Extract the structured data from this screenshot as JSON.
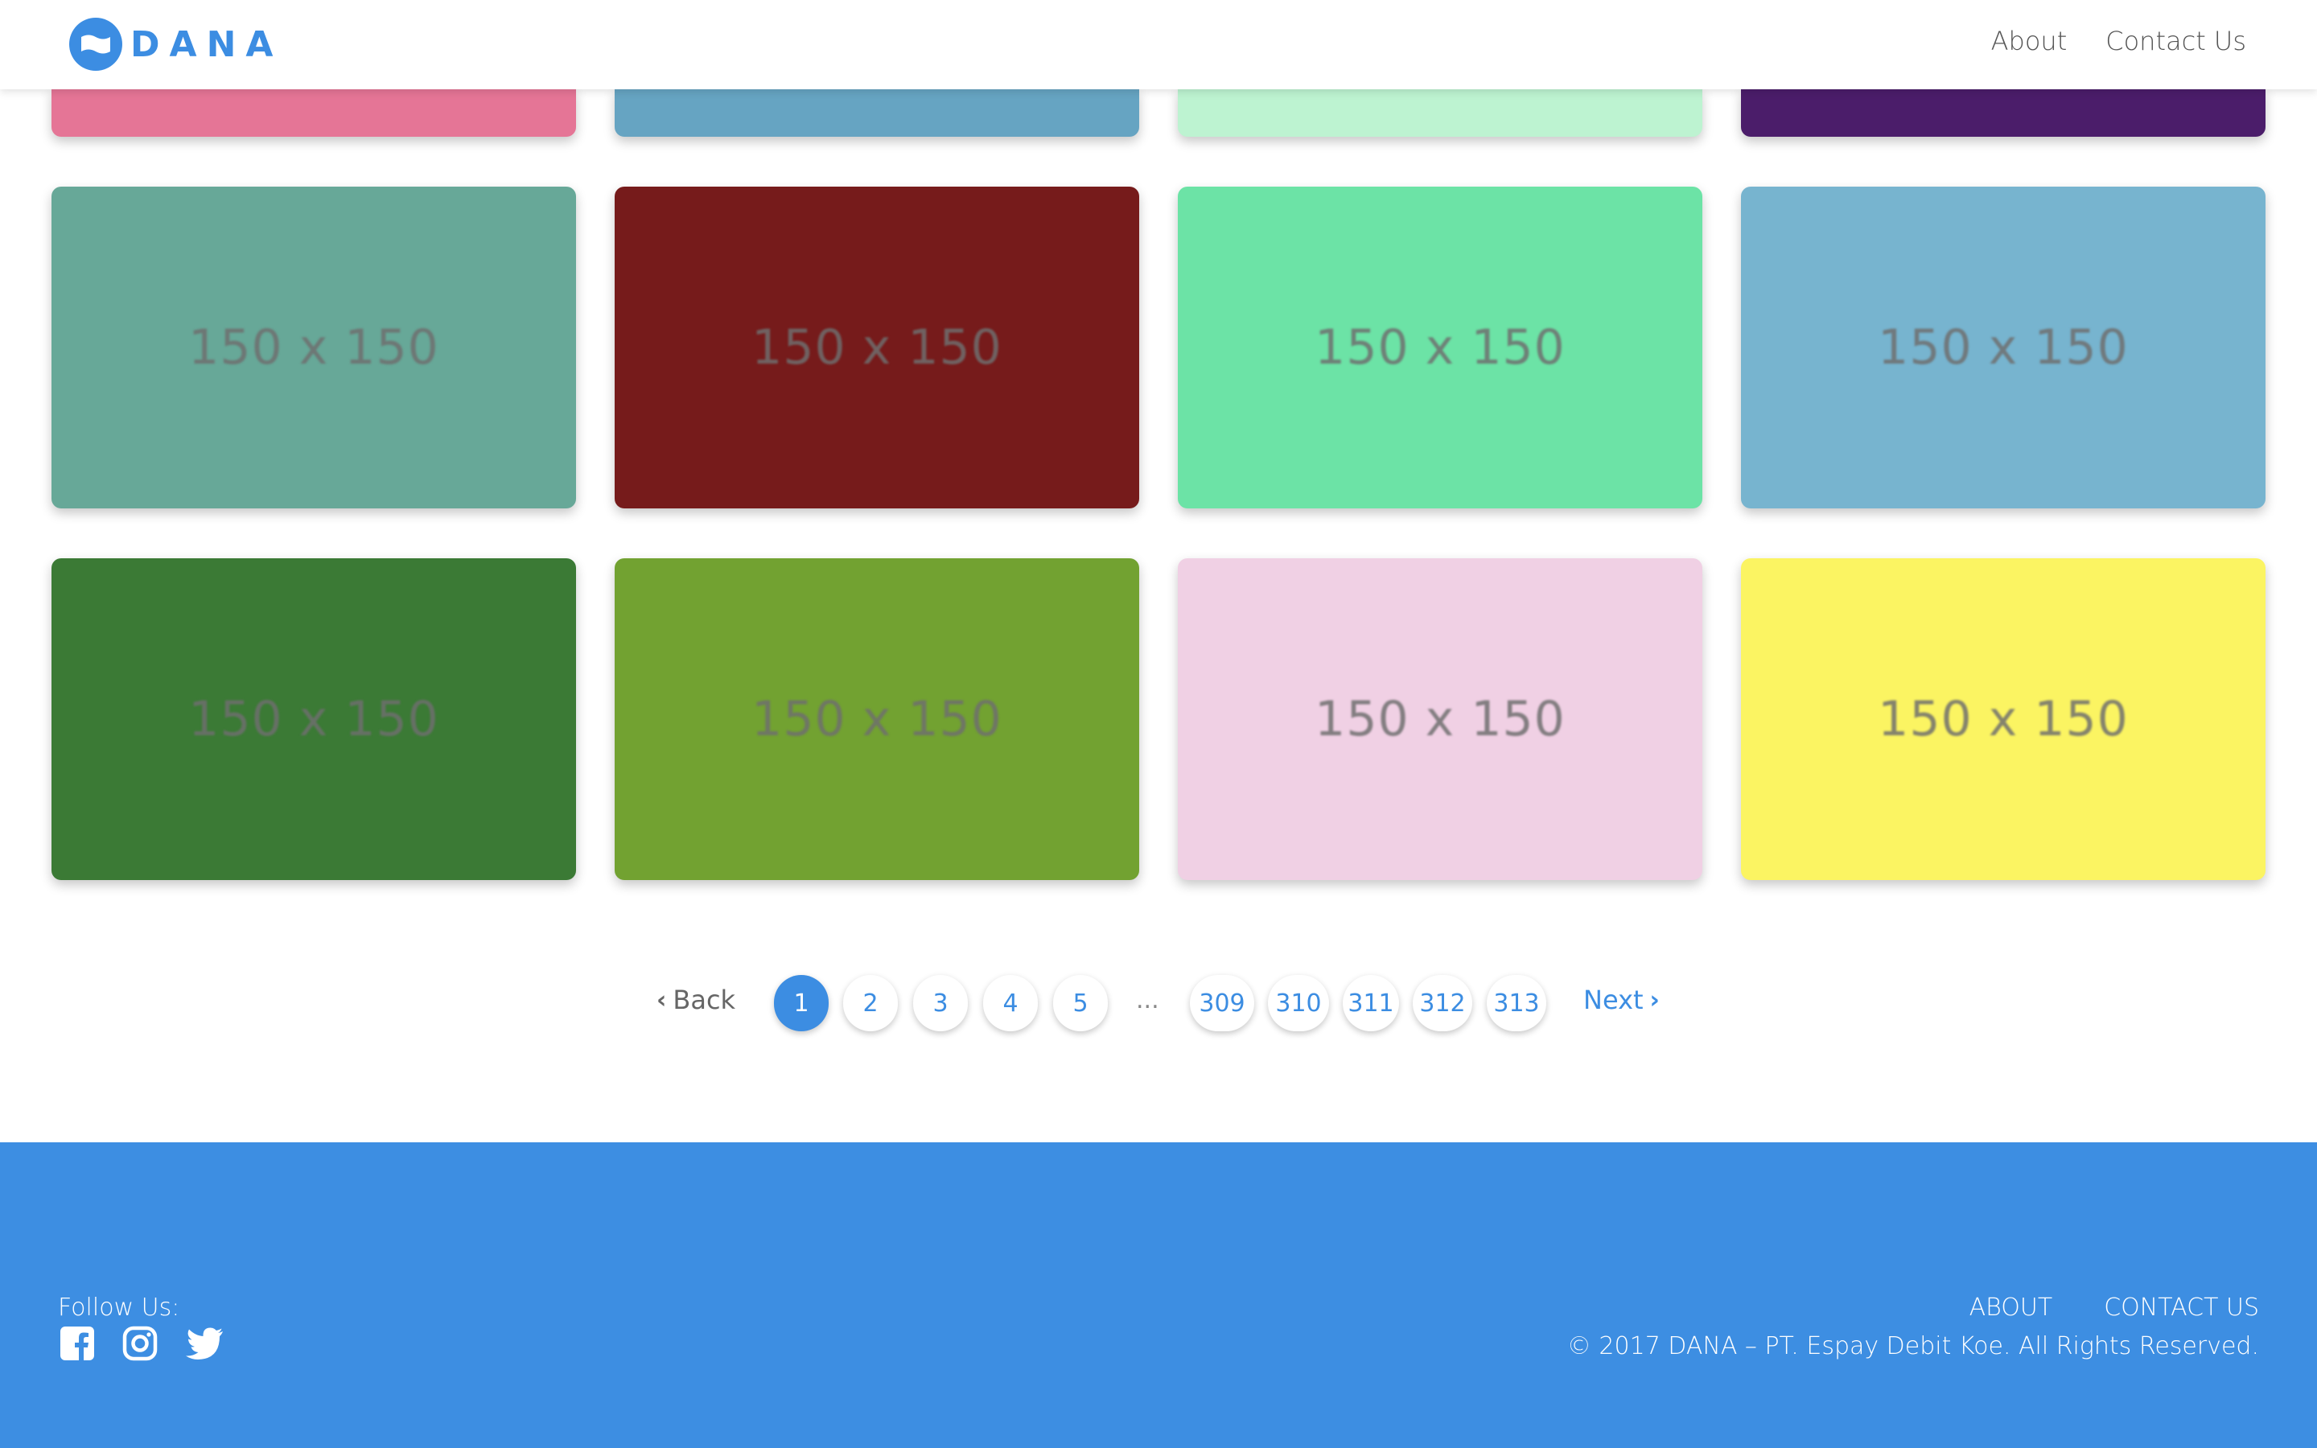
{
  "header": {
    "logo_text": "DANA",
    "nav": [
      {
        "label": "About"
      },
      {
        "label": "Contact Us"
      }
    ]
  },
  "tiles_top": [
    {
      "color": "#e57596"
    },
    {
      "color": "#66a4c2"
    },
    {
      "color": "#bdf3d1"
    },
    {
      "color": "#4b1d6a"
    }
  ],
  "tiles_row1": [
    {
      "label": "150 x 150",
      "color": "#67a898"
    },
    {
      "label": "150 x 150",
      "color": "#761b1b"
    },
    {
      "label": "150 x 150",
      "color": "#6ce3a6"
    },
    {
      "label": "150 x 150",
      "color": "#77b4cf"
    }
  ],
  "tiles_row2": [
    {
      "label": "150 x 150",
      "color": "#3b7a35"
    },
    {
      "label": "150 x 150",
      "color": "#72a231"
    },
    {
      "label": "150 x 150",
      "color": "#f0d0e4"
    },
    {
      "label": "150 x 150",
      "color": "#fbf462"
    }
  ],
  "pagination": {
    "back_label": "Back",
    "next_label": "Next",
    "ellipsis": "...",
    "pages": [
      "1",
      "2",
      "3",
      "4",
      "5",
      "309",
      "310",
      "311",
      "312",
      "313"
    ],
    "current": "1"
  },
  "footer": {
    "follow_label": "Follow Us:",
    "social_icons": [
      "facebook-icon",
      "instagram-icon",
      "twitter-icon"
    ],
    "links": [
      {
        "label": "ABOUT"
      },
      {
        "label": "CONTACT US"
      }
    ],
    "copyright": "© 2017 DANA – PT. Espay Debit Koe. All Rights Reserved.",
    "background": "#3d8ee2"
  },
  "colors": {
    "accent": "#3c8de2"
  }
}
